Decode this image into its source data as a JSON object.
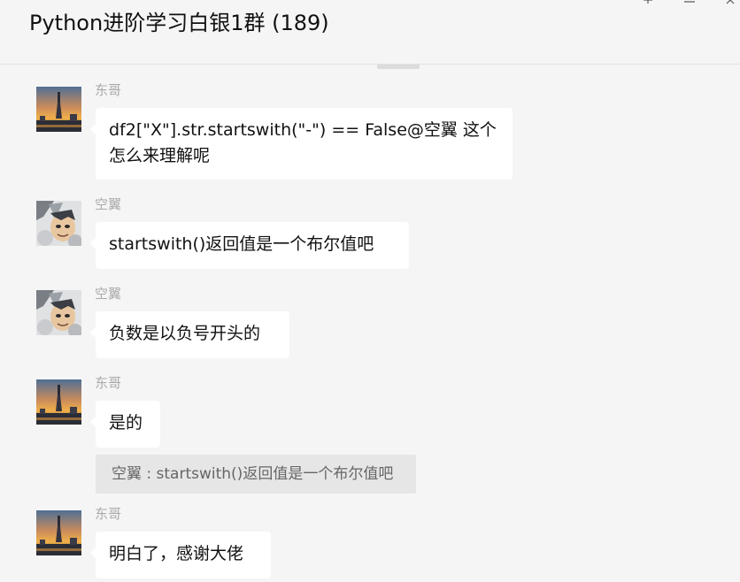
{
  "header": {
    "title": "Python进阶学习白银1群 (189)"
  },
  "colors": {
    "background": "#f5f5f5",
    "bubble": "#ffffff",
    "quote_bg": "#e6e6e6",
    "sender_name": "#a9a9a9"
  },
  "messages": [
    {
      "sender": "东哥",
      "avatar": "city-tower-sunset-avatar",
      "text": "df2[\"X\"].str.startswith(\"-\") == False@空翼 这个怎么来理解呢"
    },
    {
      "sender": "空翼",
      "avatar": "anime-character-avatar",
      "text": "startswith()返回值是一个布尔值吧"
    },
    {
      "sender": "空翼",
      "avatar": "anime-character-avatar",
      "text": "负数是以负号开头的"
    },
    {
      "sender": "东哥",
      "avatar": "city-tower-sunset-avatar",
      "text": "是的",
      "quote": "空翼 : startswith()返回值是一个布尔值吧"
    },
    {
      "sender": "东哥",
      "avatar": "city-tower-sunset-avatar",
      "text": "明白了，感谢大佬"
    }
  ]
}
